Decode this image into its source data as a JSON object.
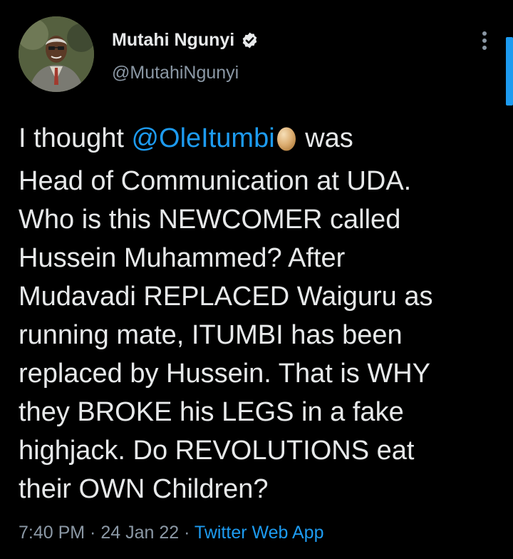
{
  "author": {
    "display_name": "Mutahi Ngunyi",
    "handle": "@MutahiNgunyi",
    "verified": true,
    "avatar_icon": "profile-photo"
  },
  "tweet": {
    "text_before_mention": "I thought ",
    "mention": "@OleItumbi",
    "mention_emoji": "egg",
    "text_after_mention": " was\nHead of Communication at UDA.\nWho is this NEWCOMER called\nHussein Muhammed? After\nMudavadi REPLACED Waiguru as\nrunning mate, ITUMBI has been\nreplaced by Hussein. That is WHY\nthey BROKE his LEGS in a fake\nhighjack. Do REVOLUTIONS eat\ntheir OWN Children?"
  },
  "meta": {
    "time": "7:40 PM",
    "separator1": " · ",
    "date": "24 Jan 22",
    "separator2": " · ",
    "source": "Twitter Web App"
  },
  "colors": {
    "background": "#000000",
    "text": "#e7e9ea",
    "secondary": "#8b98a5",
    "accent": "#1d9bf0"
  },
  "icons": {
    "more": "more-vertical-icon",
    "verified": "verified-badge-icon"
  }
}
